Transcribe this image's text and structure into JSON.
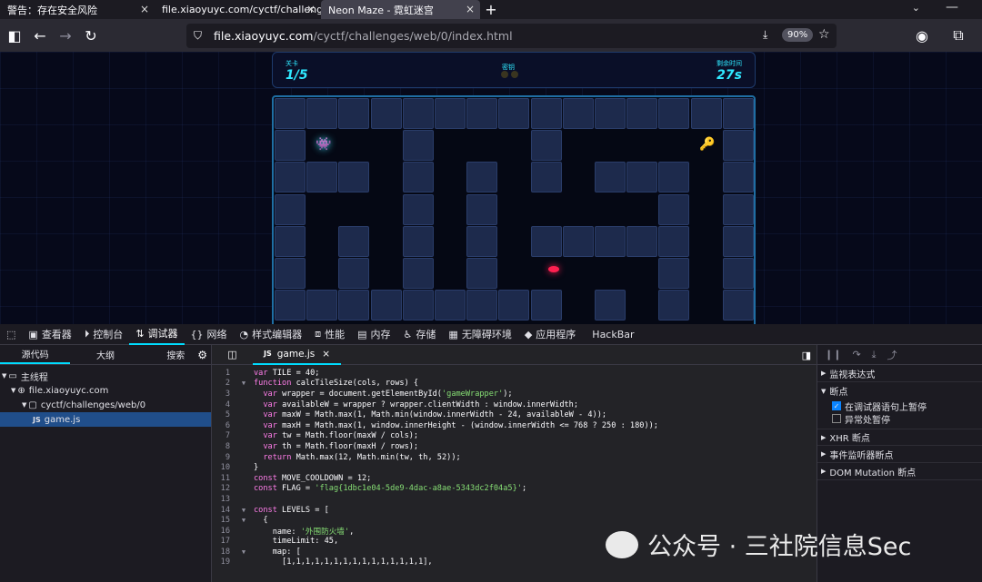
{
  "tabs": [
    {
      "label": "警告：存在安全风险"
    },
    {
      "label": "file.xiaoyuyc.com/cyctf/challenge"
    },
    {
      "label": "Neon Maze - 霓虹迷宫"
    }
  ],
  "url": {
    "host": "file.xiaoyuyc.com",
    "path": "/cyctf/challenges/web/0/index.html",
    "zoom": "90%"
  },
  "hud": {
    "level_label": "关卡",
    "level_value": "1/5",
    "keys_label": "密钥",
    "time_label": "剩余时间",
    "time_value": "27s"
  },
  "devtools": {
    "tabs": [
      "查看器",
      "控制台",
      "调试器",
      "网络",
      "样式编辑器",
      "性能",
      "内存",
      "存储",
      "无障碍环境",
      "应用程序",
      "HackBar"
    ],
    "left_tabs": [
      "源代码",
      "大纲",
      "搜索"
    ],
    "tree": [
      "主线程",
      "file.xiaoyuyc.com",
      "cyctf/challenges/web/0",
      "game.js"
    ],
    "editor_tab": "game.js",
    "code": [
      "var TILE = 40;",
      "function calcTileSize(cols, rows) {",
      "  var wrapper = document.getElementById('gameWrapper');",
      "  var availableW = wrapper ? wrapper.clientWidth : window.innerWidth;",
      "  var maxW = Math.max(1, Math.min(window.innerWidth - 24, availableW - 4));",
      "  var maxH = Math.max(1, window.innerHeight - (window.innerWidth <= 768 ? 250 : 180));",
      "  var tw = Math.floor(maxW / cols);",
      "  var th = Math.floor(maxH / rows);",
      "  return Math.max(12, Math.min(tw, th, 52));",
      "}",
      "const MOVE_COOLDOWN = 12;",
      "const FLAG = 'flag{1dbc1e04-5de9-4dac-a8ae-5343dc2f04a5}';",
      "",
      "const LEVELS = [",
      "  {",
      "    name: '外围防火墙',",
      "    timeLimit: 45,",
      "    map: [",
      "      [1,1,1,1,1,1,1,1,1,1,1,1,1,1,1],"
    ],
    "right_panel": {
      "watch": "监视表达式",
      "breakpoints": "断点",
      "pause_debugger": "在调试器语句上暂停",
      "pause_exceptions": "异常处暂停",
      "xhr": "XHR 断点",
      "event": "事件监听器断点",
      "dom": "DOM Mutation 断点"
    }
  },
  "watermark": "公众号 · 三社院信息Sec"
}
